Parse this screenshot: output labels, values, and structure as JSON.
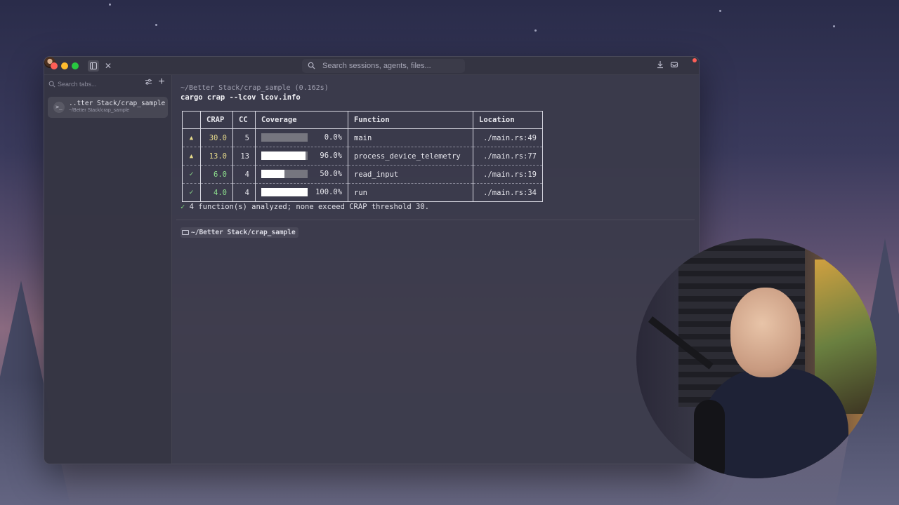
{
  "titlebar": {
    "search_placeholder": "Search sessions, agents, files..."
  },
  "sidebar": {
    "search_placeholder": "Search tabs...",
    "tabs": [
      {
        "name": "..tter Stack/crap_sample",
        "path": "~/Better Stack/crap_sample"
      }
    ]
  },
  "terminal": {
    "cwd_line": "~/Better Stack/crap_sample (0.162s)",
    "command": "cargo crap --lcov lcov.info",
    "table": {
      "headers": [
        "CRAP",
        "CC",
        "Coverage",
        "Function",
        "Location"
      ],
      "rows": [
        {
          "status": "warn",
          "status_glyph": "▲",
          "crap": "30.0",
          "cc": "5",
          "coverage_fraction": 0.0,
          "coverage_pct": "0.0%",
          "function": "main",
          "location": "./main.rs:49"
        },
        {
          "status": "warn",
          "status_glyph": "▲",
          "crap": "13.0",
          "cc": "13",
          "coverage_fraction": 0.96,
          "coverage_pct": "96.0%",
          "function": "process_device_telemetry",
          "location": "./main.rs:77"
        },
        {
          "status": "ok",
          "status_glyph": "✓",
          "crap": "6.0",
          "cc": "4",
          "coverage_fraction": 0.5,
          "coverage_pct": "50.0%",
          "function": "read_input",
          "location": "./main.rs:19"
        },
        {
          "status": "ok",
          "status_glyph": "✓",
          "crap": "4.0",
          "cc": "4",
          "coverage_fraction": 1.0,
          "coverage_pct": "100.0%",
          "function": "run",
          "location": "./main.rs:34"
        }
      ]
    },
    "summary_check": "✓",
    "summary": "4 function(s) analyzed; none exceed CRAP threshold 30.",
    "prompt_path": "~/Better Stack/crap_sample"
  },
  "colors": {
    "warn": "#e8dc8c",
    "ok": "#8ee08e",
    "traffic_red": "#fe5f57",
    "traffic_yellow": "#febc2e",
    "traffic_green": "#28c840"
  }
}
